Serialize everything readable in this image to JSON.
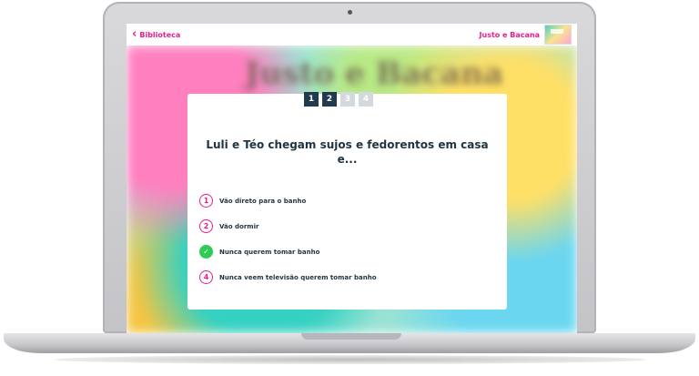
{
  "topbar": {
    "back_label": "Biblioteca",
    "book_title": "Justo e Bacana"
  },
  "background": {
    "blurred_title": "Justo e Bacana"
  },
  "quiz": {
    "steps": [
      "1",
      "2",
      "3",
      "4"
    ],
    "current_step": 2,
    "question": "Luli e Téo chegam sujos e fedorentos em casa e...",
    "options": [
      {
        "marker": "1",
        "label": "Vão direto para o banho",
        "state": "default"
      },
      {
        "marker": "2",
        "label": "Vão dormir",
        "state": "default"
      },
      {
        "marker": "✓",
        "label": "Nunca querem tomar banho",
        "state": "correct"
      },
      {
        "marker": "4",
        "label": "Nunca veem televisão querem tomar banho",
        "state": "default"
      }
    ]
  },
  "colors": {
    "accent": "#e91e8c",
    "step_done": "#1f3b4d",
    "step_todo": "#d3d9dd",
    "correct": "#2ecc57"
  }
}
